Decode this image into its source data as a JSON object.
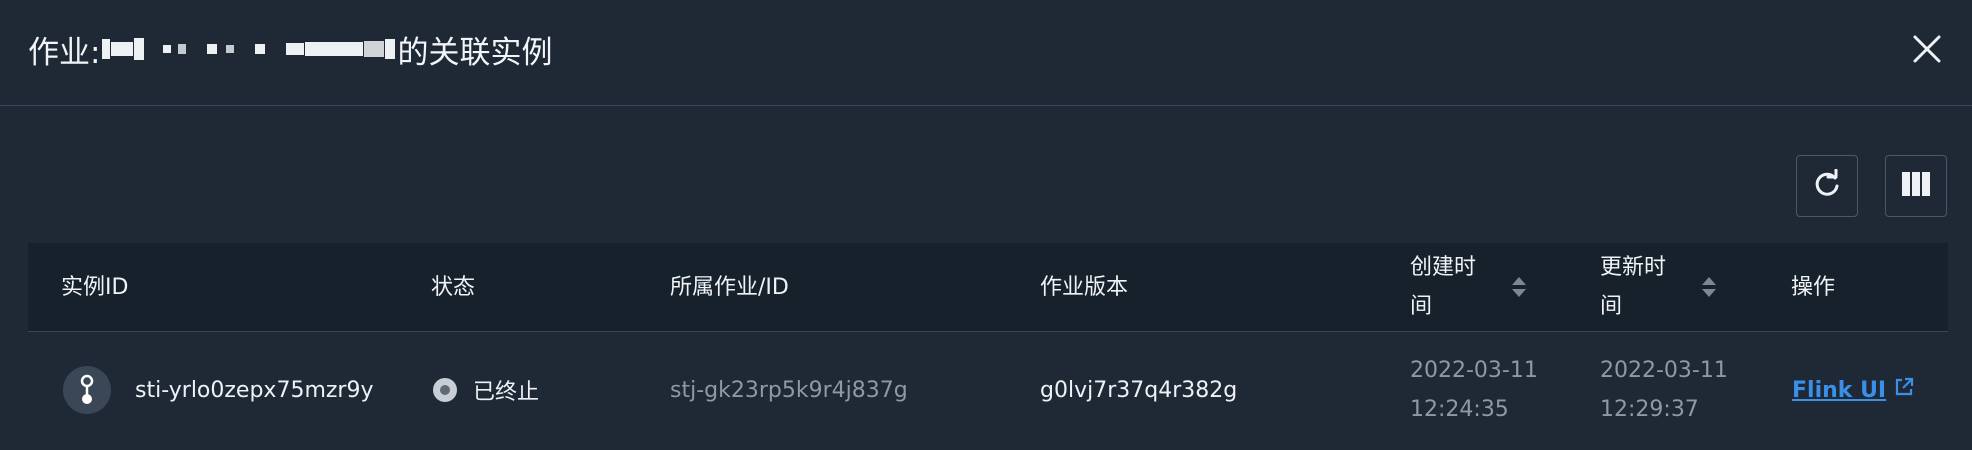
{
  "dialog": {
    "title_prefix": "作业:",
    "title_suffix": "的关联实例"
  },
  "toolbar": {
    "refresh_icon": "refresh-icon",
    "columns_icon": "columns-icon"
  },
  "table": {
    "headers": {
      "instance_id": "实例ID",
      "status": "状态",
      "job": "所属作业/ID",
      "version": "作业版本",
      "created_line1": "创建时",
      "created_line2": "间",
      "updated_line1": "更新时",
      "updated_line2": "间",
      "actions": "操作"
    },
    "rows": [
      {
        "instance_id": "sti-yrlo0zepx75mzr9y",
        "status": "已终止",
        "job": "stj-gk23rp5k9r4j837g",
        "version": "g0lvj7r37q4r382g",
        "created_date": "2022-03-11",
        "created_time": "12:24:35",
        "updated_date": "2022-03-11",
        "updated_time": "12:29:37",
        "action": "Flink UI"
      }
    ]
  },
  "colors": {
    "background": "#1f2936",
    "header_row": "#17212c",
    "link": "#3a8fe6",
    "muted_text": "#8f99a5"
  }
}
